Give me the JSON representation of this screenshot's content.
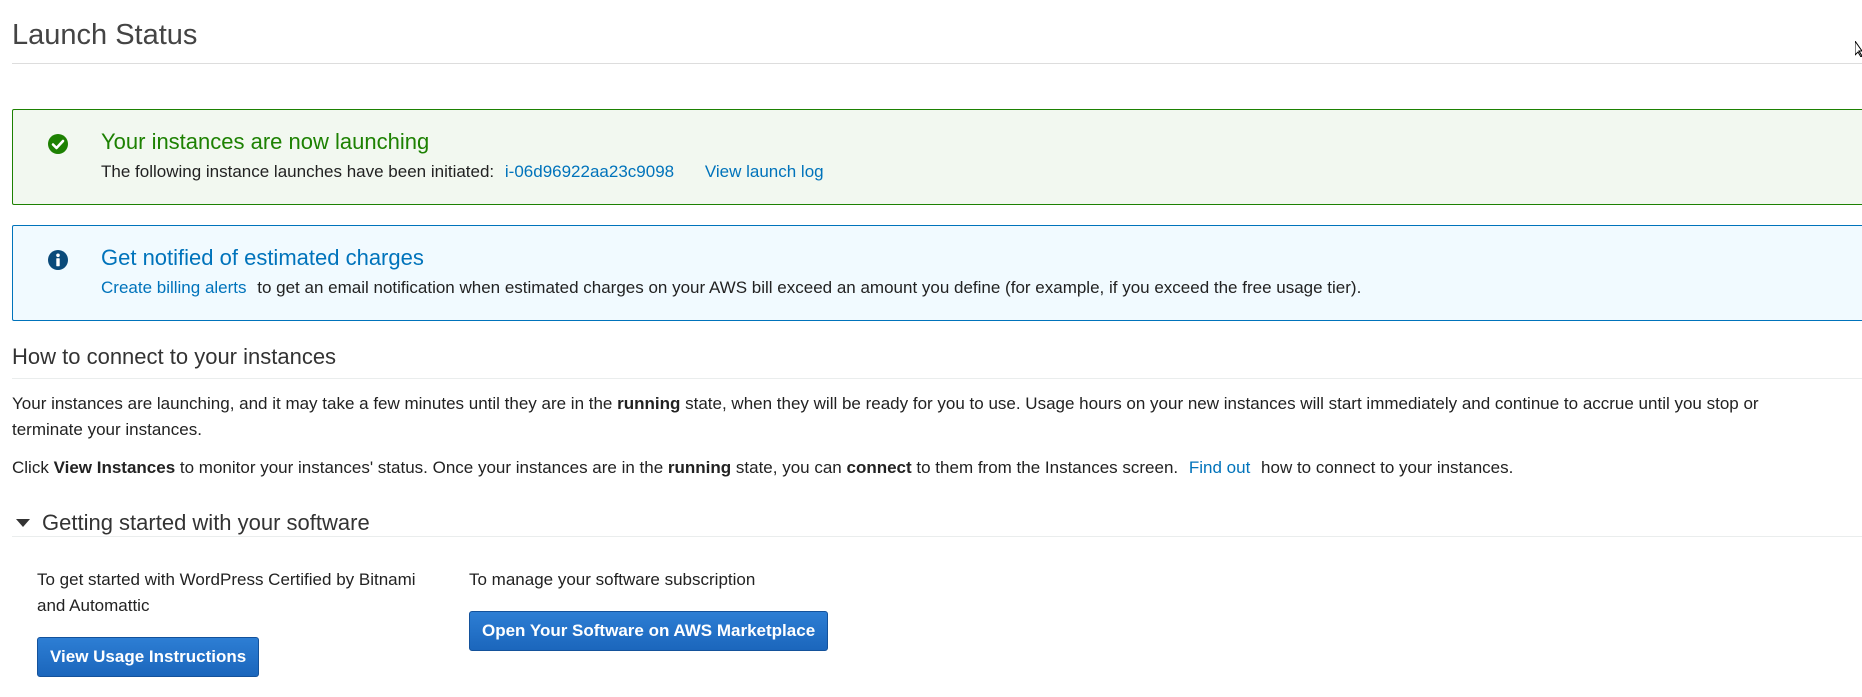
{
  "page": {
    "title": "Launch Status"
  },
  "success_alert": {
    "title": "Your instances are now launching",
    "body_prefix": "The following instance launches have been initiated:",
    "instance_id": "i-06d96922aa23c9098",
    "view_log_link": "View launch log",
    "color": "#1d8102"
  },
  "info_alert": {
    "title": "Get notified of estimated charges",
    "billing_link": "Create billing alerts",
    "body_suffix": "to get an email notification when estimated charges on your AWS bill exceed an amount you define (for example, if you exceed the free usage tier).",
    "color": "#0073bb"
  },
  "connect": {
    "heading": "How to connect to your instances",
    "para1_a": "Your instances are launching, and it may take a few minutes until they are in the",
    "para1_b": "running",
    "para1_c": "state, when they will be ready for you to use. Usage hours on your new instances will start immediately and continue to accrue until you stop or terminate your instances.",
    "para2_a": "Click",
    "para2_b": "View Instances",
    "para2_c": "to monitor your instances' status. Once your instances are in the",
    "para2_d": "running",
    "para2_e": "state, you can",
    "para2_f": "connect",
    "para2_g": "to them from the Instances screen.",
    "find_out_link": "Find out",
    "para2_h": "how to connect to your instances."
  },
  "getting_started": {
    "title": "Getting started with your software",
    "col1_text": "To get started with WordPress Certified by Bitnami and Automattic",
    "usage_button": "View Usage Instructions",
    "col2_text": "To manage your software subscription",
    "marketplace_button": "Open Your Software on AWS Marketplace",
    "button_color": "#1b66bc"
  },
  "icons": {
    "success": "check-circle-icon",
    "info": "info-circle-icon",
    "caret": "caret-down-icon",
    "cursor": "mouse-cursor-icon"
  }
}
